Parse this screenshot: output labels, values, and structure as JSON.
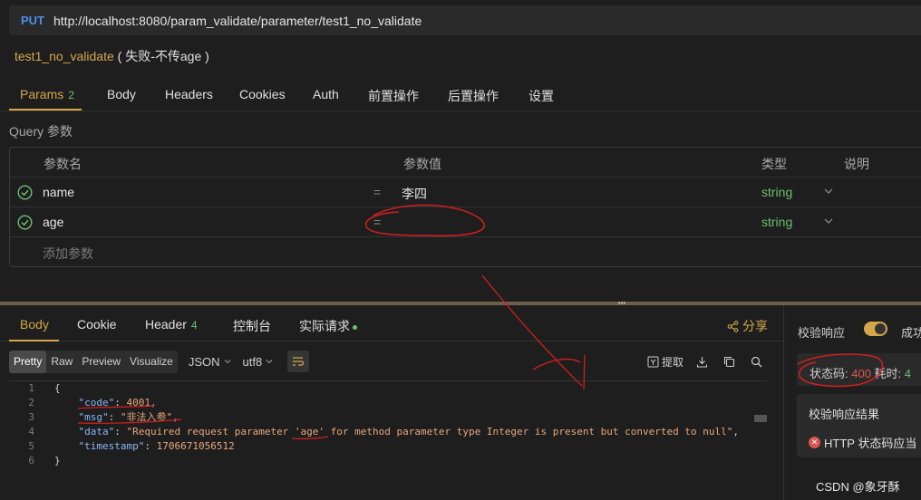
{
  "request": {
    "method": "PUT",
    "url": "http://localhost:8080/param_validate/parameter/test1_no_validate",
    "name": "test1_no_validate",
    "name_suffix": "( 失败-不传age )"
  },
  "request_tabs": {
    "params": "Params",
    "params_count": "2",
    "body": "Body",
    "headers": "Headers",
    "cookies": "Cookies",
    "auth": "Auth",
    "pre": "前置操作",
    "post": "后置操作",
    "settings": "设置"
  },
  "query": {
    "label": "Query 参数",
    "headers": {
      "name": "参数名",
      "value": "参数值",
      "type": "类型",
      "desc": "说明"
    },
    "rows": [
      {
        "name": "name",
        "eq": "=",
        "value": "李四",
        "type": "string"
      },
      {
        "name": "age",
        "eq": "=",
        "value": "",
        "type": "string"
      }
    ],
    "add_placeholder": "添加参数"
  },
  "response_tabs": {
    "body": "Body",
    "cookie": "Cookie",
    "header": "Header",
    "header_count": "4",
    "console": "控制台",
    "actual": "实际请求",
    "share": "分享"
  },
  "format": {
    "modes": [
      "Pretty",
      "Raw",
      "Preview",
      "Visualize"
    ],
    "lang": "JSON",
    "encoding": "utf8",
    "extract": "提取"
  },
  "response_body": {
    "line_numbers": [
      "1",
      "2",
      "3",
      "4",
      "5",
      "6"
    ],
    "open": "{",
    "close": "}",
    "code_key": "\"code\"",
    "code_val": "4001",
    "msg_key": "\"msg\"",
    "msg_val": "\"非法入参\"",
    "data_key": "\"data\"",
    "data_val": "\"Required request parameter 'age' for method parameter type Integer is present but converted to null\"",
    "ts_key": "\"timestamp\"",
    "ts_val": "1706671056512"
  },
  "validation": {
    "label": "校验响应",
    "success": "成功",
    "status_label": "状态码: ",
    "status_code": "400",
    "time_label": " 耗时: ",
    "time_value": "4",
    "result_title": "校验响应结果",
    "result_text": "HTTP 状态码应当"
  },
  "watermark": "CSDN @象牙酥",
  "colors": {
    "accent": "#d4a84a",
    "success": "#6cc070",
    "error": "#e05a4f",
    "method": "#4f8de8",
    "annotation": "#d21f1f"
  }
}
